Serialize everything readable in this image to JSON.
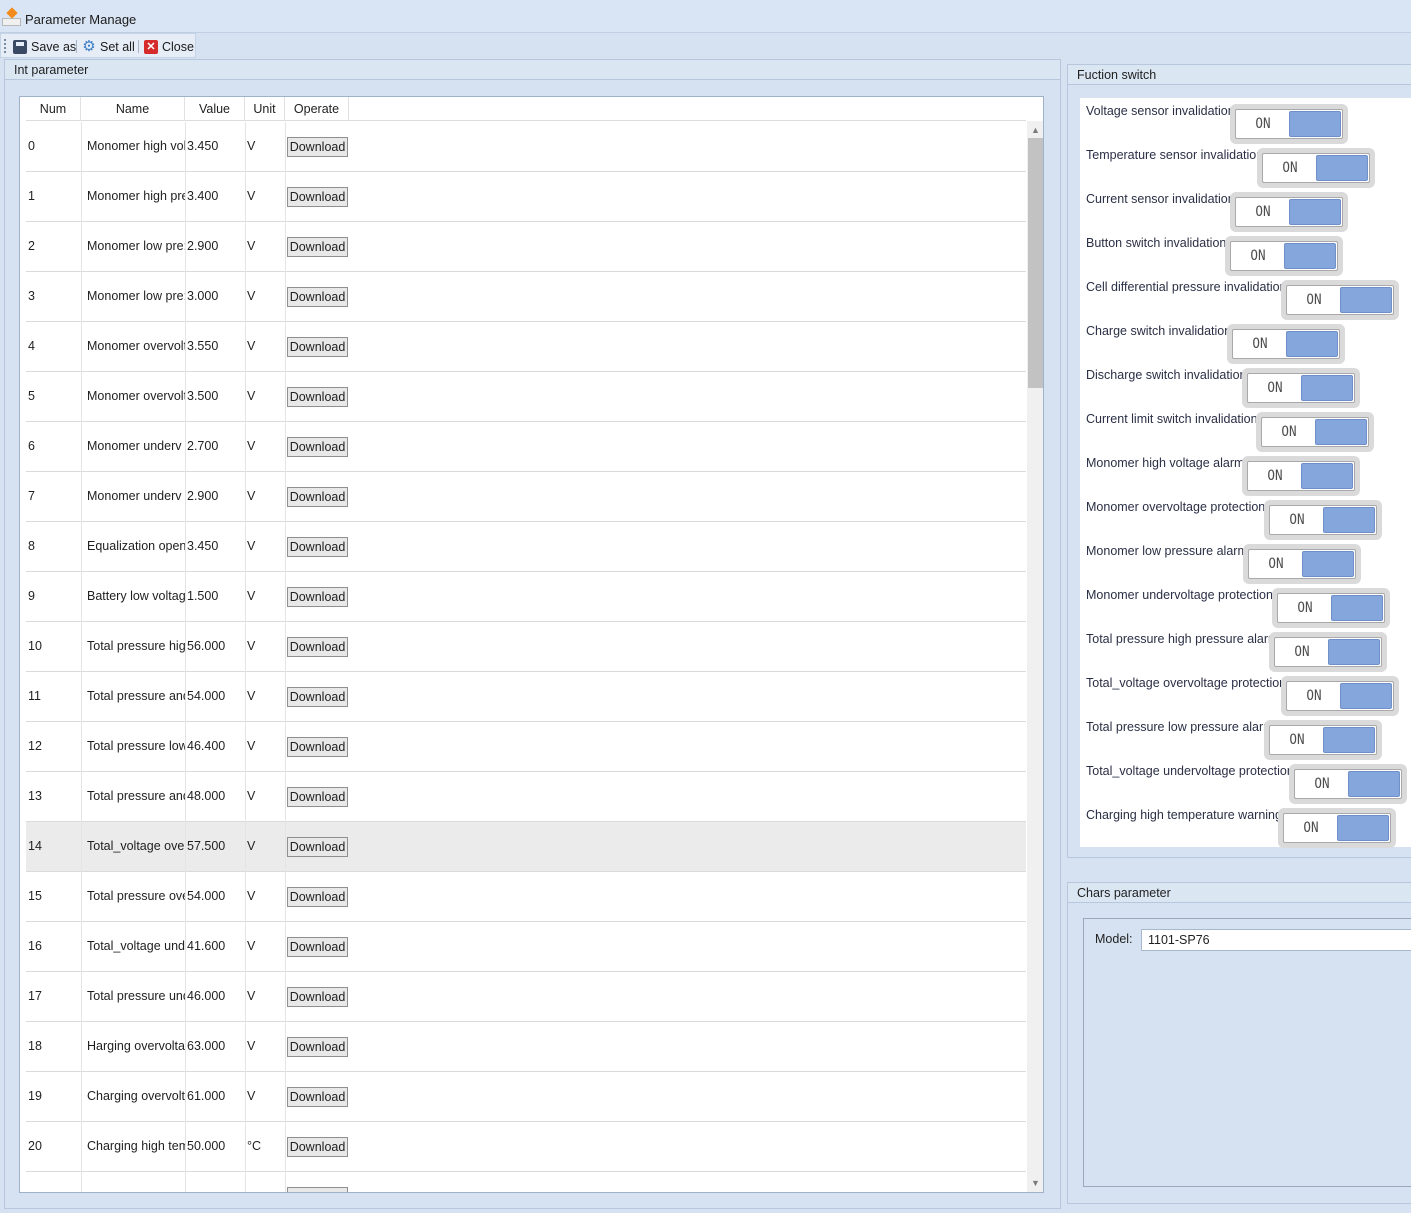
{
  "window": {
    "title": "Parameter Manage"
  },
  "toolbar": {
    "save_as": "Save as",
    "set_all": "Set all",
    "close": "Close"
  },
  "int_parameter": {
    "title": "Int parameter",
    "columns": {
      "num": "Num",
      "name": "Name",
      "value": "Value",
      "unit": "Unit",
      "operate": "Operate"
    },
    "download_label": "Download",
    "rows": [
      {
        "num": "0",
        "name": "Monomer high vol",
        "value": "3.450",
        "unit": "V"
      },
      {
        "num": "1",
        "name": "Monomer high pre",
        "value": "3.400",
        "unit": "V"
      },
      {
        "num": "2",
        "name": "Monomer low pre:",
        "value": "2.900",
        "unit": "V"
      },
      {
        "num": "3",
        "name": "Monomer low pre:",
        "value": "3.000",
        "unit": "V"
      },
      {
        "num": "4",
        "name": "Monomer overvolt",
        "value": "3.550",
        "unit": "V"
      },
      {
        "num": "5",
        "name": "Monomer overvolt",
        "value": "3.500",
        "unit": "V"
      },
      {
        "num": "6",
        "name": "Monomer underv",
        "value": "2.700",
        "unit": "V"
      },
      {
        "num": "7",
        "name": "Monomer underv",
        "value": "2.900",
        "unit": "V"
      },
      {
        "num": "8",
        "name": "Equalization openi",
        "value": "3.450",
        "unit": "V"
      },
      {
        "num": "9",
        "name": "Battery low voltag",
        "value": "1.500",
        "unit": "V"
      },
      {
        "num": "10",
        "name": "Total pressure high",
        "value": "56.000",
        "unit": "V"
      },
      {
        "num": "11",
        "name": "Total pressure and",
        "value": "54.000",
        "unit": "V"
      },
      {
        "num": "12",
        "name": "Total pressure low",
        "value": "46.400",
        "unit": "V"
      },
      {
        "num": "13",
        "name": "Total pressure and",
        "value": "48.000",
        "unit": "V"
      },
      {
        "num": "14",
        "name": "Total_voltage over",
        "value": "57.500",
        "unit": "V"
      },
      {
        "num": "15",
        "name": "Total pressure ove",
        "value": "54.000",
        "unit": "V"
      },
      {
        "num": "16",
        "name": "Total_voltage unde",
        "value": "41.600",
        "unit": "V"
      },
      {
        "num": "17",
        "name": "Total pressure und",
        "value": "46.000",
        "unit": "V"
      },
      {
        "num": "18",
        "name": "Harging overvolta",
        "value": "63.000",
        "unit": "V"
      },
      {
        "num": "19",
        "name": "Charging overvolt",
        "value": "61.000",
        "unit": "V"
      },
      {
        "num": "20",
        "name": "Charging high tem",
        "value": "50.000",
        "unit": "°C"
      }
    ]
  },
  "function_switch": {
    "title": "Fuction switch",
    "on_label": "ON",
    "items": [
      {
        "label": "Voltage sensor invalidation"
      },
      {
        "label": "Temperature sensor invalidation"
      },
      {
        "label": "Current sensor invalidation"
      },
      {
        "label": "Button switch invalidation"
      },
      {
        "label": "Cell differential pressure invalidation"
      },
      {
        "label": "Charge switch invalidation"
      },
      {
        "label": "Discharge switch invalidation"
      },
      {
        "label": "Current limit switch invalidation"
      },
      {
        "label": "Monomer high voltage alarm"
      },
      {
        "label": "Monomer overvoltage protection"
      },
      {
        "label": "Monomer low pressure alarm"
      },
      {
        "label": "Monomer undervoltage protection"
      },
      {
        "label": "Total pressure high pressure alarm"
      },
      {
        "label": "Total_voltage overvoltage protection"
      },
      {
        "label": "Total pressure low pressure alarm"
      },
      {
        "label": "Total_voltage undervoltage protection"
      },
      {
        "label": "Charging high temperature warning"
      }
    ]
  },
  "chars_parameter": {
    "title": "Chars parameter",
    "model_label": "Model:",
    "model_value": "1101-SP76"
  }
}
